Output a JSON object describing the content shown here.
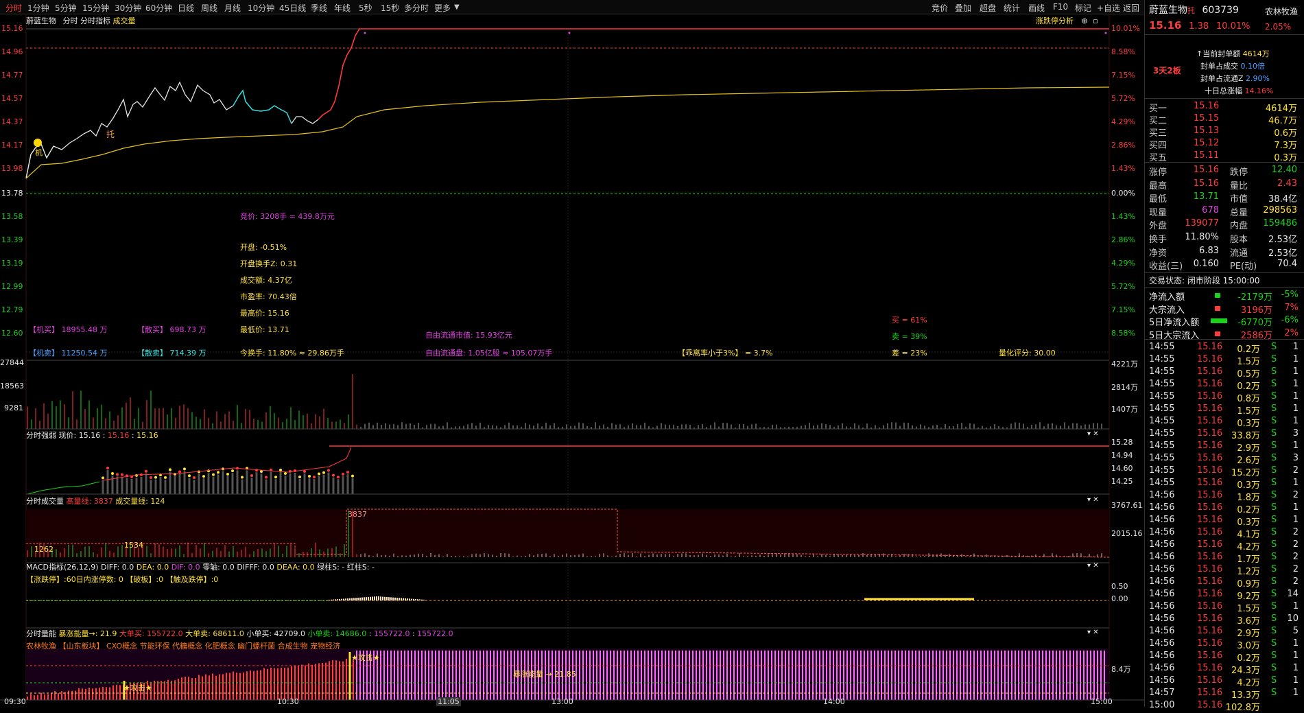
{
  "toolbar": {
    "tabs": [
      "分时",
      "1分钟",
      "5分钟",
      "15分钟",
      "30分钟",
      "60分钟",
      "日线",
      "周线",
      "月线",
      "10分钟",
      "45日线",
      "季线",
      "年线",
      "5秒",
      "15秒",
      "多分时",
      "更多"
    ],
    "right_tools": [
      "竞价",
      "叠加",
      "超盘",
      "统计",
      "画线",
      "F10",
      "标记",
      "+自选",
      "返回"
    ]
  },
  "main": {
    "stock_name": "蔚蓝生物",
    "sub_tabs": [
      "分时",
      "分时指标",
      "成交量"
    ],
    "limit_analysis": "涨跌停分析",
    "price_ticks": [
      "15.16",
      "14.96",
      "14.77",
      "14.57",
      "14.37",
      "14.17",
      "13.98",
      "13.78",
      "13.58",
      "13.39",
      "13.19",
      "12.99",
      "12.79",
      "12.60"
    ],
    "pct_ticks": [
      "10.01%",
      "8.58%",
      "7.15%",
      "5.72%",
      "4.29%",
      "2.86%",
      "1.43%",
      "0.00%",
      "1.43%",
      "2.86%",
      "4.29%",
      "5.72%",
      "7.15%",
      "8.58%"
    ],
    "markers": {
      "tuo": "托",
      "ji": "机"
    },
    "auction": "竞价: 3208手 = 439.8万元",
    "info_lines": [
      "开盘: -0.51%",
      "开盘换手Z: 0.31",
      "成交额: 4.37亿",
      "市盈率: 70.43倍",
      "最高价: 15.16",
      "最低价: 13.71"
    ],
    "bottom_info": {
      "jimai": "【机买】 18955.48 万",
      "sanmai": "【散买】 698.73 万",
      "jimai2": "【机卖】 11250.54 万",
      "sanmai2": "【散卖】 714.39 万",
      "turnover": "今换手: 11.80% ≈ 29.86万手",
      "free_cap": "自由流通市值: 15.93亿元",
      "free_shares": "自由流通盘: 1.05亿股 ≈ 105.07万手",
      "lisan": "【乖离率小于3%】 = 3.7%",
      "buy": "买 = 61%",
      "sell": "卖 = 39%",
      "diff": "差 = 23%",
      "score": "量化评分: 30.00"
    },
    "vol_ticks_left": [
      "27844",
      "18563",
      "9281"
    ],
    "vol_ticks_right": [
      "4221万",
      "2814万",
      "1407万"
    ]
  },
  "panels": {
    "qiangruo": {
      "title": "分时强弱",
      "now_label": "现价: 15.16",
      "v1": "15.16",
      "v2": "15.16",
      "ticks": [
        "15.28",
        "14.94",
        "14.60",
        "14.25"
      ]
    },
    "chengjiao": {
      "title": "分时成交量",
      "hi_label": "高量线: 3837",
      "vol_label": "成交量线: 124",
      "ticks": [
        "3767.61",
        "2015.16"
      ],
      "peak": "3837",
      "a": "1534",
      "b": "1262"
    },
    "macd": {
      "title": "MACD指标(26,12,9)",
      "diff": "DIFF: 0.0",
      "dea": "DEA: 0.0",
      "dif2": "DIF: 0.0",
      "lingzhou": "零轴: 0.0",
      "difff": "DIFFF: 0.0",
      "deaa": "DEAA: 0.0",
      "lv": "绿柱S: -",
      "hong": "红柱S: -",
      "line2": "【涨跌停】:60日内涨停数: 0 【破板】:0 【触及跌停】:0",
      "ticks": [
        "0.50",
        "0.00"
      ]
    },
    "liangneng": {
      "title": "分时量能",
      "bao": "暴涨能量→: 21.9",
      "dadanmai": "大单买: 155722.0",
      "dadanmai2": "大单卖: 68611.0",
      "xiaodanmai": "小单买: 42709.0",
      "xiaodanmai2": "小单卖: 14686.0",
      "v1": "155722.0",
      "v2": "155722.0",
      "concepts": "农林牧渔 【山东板块】 CXO概念 节能环保 代糖概念 化肥概念 幽门螺杆菌 合成生物 宠物经济",
      "gongji": "★攻击★",
      "baozhang": "暴涨能量 → 21.85",
      "tick": "8.4万"
    }
  },
  "time_axis": [
    "09:30",
    "10:30",
    "11:05",
    "13:00",
    "14:00",
    "15:00"
  ],
  "quote": {
    "name": "蔚蓝生物",
    "badge": "托",
    "code": "603739",
    "sector": "农林牧渔",
    "price": "15.16",
    "change": "1.38",
    "pct": "10.01%",
    "sector_pct": "2.05%",
    "seal_lines": [
      {
        "label": "↑当前封单额",
        "value": "4614万"
      },
      {
        "label": "封单占成交",
        "value": "0.10倍"
      },
      {
        "label": "封单占流通Z",
        "value": "2.90%"
      },
      {
        "label": "十日总涨幅",
        "value": "14.16%"
      }
    ],
    "board": "3天2板",
    "bids": [
      {
        "label": "买一",
        "price": "15.16",
        "vol": "4614万"
      },
      {
        "label": "买二",
        "price": "15.15",
        "vol": "46.7万"
      },
      {
        "label": "买三",
        "price": "15.13",
        "vol": "0.6万"
      },
      {
        "label": "买四",
        "price": "15.12",
        "vol": "7.3万"
      },
      {
        "label": "买五",
        "price": "15.11",
        "vol": "0.3万"
      }
    ],
    "stats": [
      {
        "l1": "涨停",
        "v1": "15.16",
        "l2": "跌停",
        "v2": "12.40"
      },
      {
        "l1": "最高",
        "v1": "15.16",
        "l2": "量比",
        "v2": "2.43"
      },
      {
        "l1": "最低",
        "v1": "13.71",
        "l2": "市值",
        "v2": "38.4亿"
      },
      {
        "l1": "现量",
        "v1": "678",
        "l2": "总量",
        "v2": "298563"
      },
      {
        "l1": "外盘",
        "v1": "139077",
        "l2": "内盘",
        "v2": "159486"
      },
      {
        "l1": "换手",
        "v1": "11.80%",
        "l2": "股本",
        "v2": "2.53亿"
      },
      {
        "l1": "净资",
        "v1": "6.83",
        "l2": "流通",
        "v2": "2.53亿"
      },
      {
        "l1": "收益(三)",
        "v1": "0.160",
        "l2": "PE(动)",
        "v2": "70.4"
      }
    ],
    "trade_status": "交易状态: 闭市阶段 15:00:00",
    "flows": [
      {
        "label": "净流入额",
        "value": "-2179万",
        "pct": "-5%"
      },
      {
        "label": "大宗流入",
        "value": "3196万",
        "pct": "7%"
      },
      {
        "label": "5日净流入额",
        "value": "-6770万",
        "pct": "-6%"
      },
      {
        "label": "5日大宗流入",
        "value": "2586万",
        "pct": "2%"
      }
    ],
    "ticks": [
      {
        "t": "14:55",
        "p": "15.16",
        "v": "0.2万",
        "d": "S",
        "n": "1"
      },
      {
        "t": "14:55",
        "p": "15.16",
        "v": "1.5万",
        "d": "S",
        "n": "1"
      },
      {
        "t": "14:55",
        "p": "15.16",
        "v": "0.5万",
        "d": "S",
        "n": "1"
      },
      {
        "t": "14:55",
        "p": "15.16",
        "v": "0.2万",
        "d": "S",
        "n": "1"
      },
      {
        "t": "14:55",
        "p": "15.16",
        "v": "0.8万",
        "d": "S",
        "n": "1"
      },
      {
        "t": "14:55",
        "p": "15.16",
        "v": "1.5万",
        "d": "S",
        "n": "1"
      },
      {
        "t": "14:55",
        "p": "15.16",
        "v": "0.3万",
        "d": "S",
        "n": "1"
      },
      {
        "t": "14:55",
        "p": "15.16",
        "v": "33.8万",
        "d": "S",
        "n": "3"
      },
      {
        "t": "14:55",
        "p": "15.16",
        "v": "2.9万",
        "d": "S",
        "n": "1"
      },
      {
        "t": "14:55",
        "p": "15.16",
        "v": "2.6万",
        "d": "S",
        "n": "3"
      },
      {
        "t": "14:55",
        "p": "15.16",
        "v": "15.2万",
        "d": "S",
        "n": "2"
      },
      {
        "t": "14:55",
        "p": "15.16",
        "v": "0.3万",
        "d": "S",
        "n": "1"
      },
      {
        "t": "14:56",
        "p": "15.16",
        "v": "1.8万",
        "d": "S",
        "n": "2"
      },
      {
        "t": "14:56",
        "p": "15.16",
        "v": "0.2万",
        "d": "S",
        "n": "1"
      },
      {
        "t": "14:56",
        "p": "15.16",
        "v": "0.3万",
        "d": "S",
        "n": "1"
      },
      {
        "t": "14:56",
        "p": "15.16",
        "v": "4.1万",
        "d": "S",
        "n": "2"
      },
      {
        "t": "14:56",
        "p": "15.16",
        "v": "4.2万",
        "d": "S",
        "n": "2"
      },
      {
        "t": "14:56",
        "p": "15.16",
        "v": "1.7万",
        "d": "S",
        "n": "2"
      },
      {
        "t": "14:56",
        "p": "15.16",
        "v": "1.2万",
        "d": "S",
        "n": "2"
      },
      {
        "t": "14:56",
        "p": "15.16",
        "v": "0.9万",
        "d": "S",
        "n": "2"
      },
      {
        "t": "14:56",
        "p": "15.16",
        "v": "9.2万",
        "d": "S",
        "n": "14"
      },
      {
        "t": "14:56",
        "p": "15.16",
        "v": "1.5万",
        "d": "S",
        "n": "1"
      },
      {
        "t": "14:56",
        "p": "15.16",
        "v": "3.6万",
        "d": "S",
        "n": "10"
      },
      {
        "t": "14:56",
        "p": "15.16",
        "v": "2.9万",
        "d": "S",
        "n": "5"
      },
      {
        "t": "14:56",
        "p": "15.16",
        "v": "3.0万",
        "d": "S",
        "n": "1"
      },
      {
        "t": "14:56",
        "p": "15.16",
        "v": "0.2万",
        "d": "S",
        "n": "1"
      },
      {
        "t": "14:56",
        "p": "15.16",
        "v": "24.3万",
        "d": "S",
        "n": "1"
      },
      {
        "t": "14:56",
        "p": "15.16",
        "v": "4.2万",
        "d": "S",
        "n": "1"
      },
      {
        "t": "14:57",
        "p": "15.16",
        "v": "13.3万",
        "d": "S",
        "n": "1"
      },
      {
        "t": "15:00",
        "p": "15.16",
        "v": "102.8万",
        "d": "",
        "n": ""
      }
    ]
  },
  "colors": {
    "up": "#ff3b3b",
    "down": "#19d219",
    "avg": "#e6c21a",
    "white_line": "#e6e6e6",
    "cyan": "#33e0e0"
  }
}
